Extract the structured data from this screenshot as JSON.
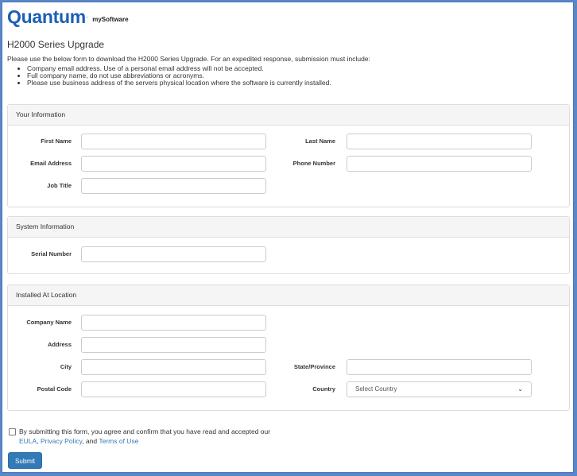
{
  "brand": {
    "logo_text": "Quantum",
    "tm": ".",
    "product": "mySoftware"
  },
  "page": {
    "title": "H2000 Series Upgrade",
    "intro": "Please use the below form to download the H2000 Series Upgrade. For an expedited response, submission must include:",
    "requirements": [
      "Company email address. Use of a personal email address will not be accepted.",
      "Full company name, do not use abbreviations or acronyms.",
      "Please use business address of the servers physical location where the software is currently installed."
    ]
  },
  "your_info": {
    "heading": "Your Information",
    "first_name_label": "First Name",
    "last_name_label": "Last Name",
    "email_label": "Email Address",
    "phone_label": "Phone Number",
    "job_title_label": "Job Title"
  },
  "system_info": {
    "heading": "System Information",
    "serial_label": "Serial Number"
  },
  "location": {
    "heading": "Installed At Location",
    "company_label": "Company Name",
    "address_label": "Address",
    "city_label": "City",
    "state_label": "State/Province",
    "postal_label": "Postal Code",
    "country_label": "Country",
    "country_value": "Select Country"
  },
  "agreement": {
    "text_before": "By submitting this form, you agree and confirm that you have read and accepted our",
    "eula": "EULA",
    "sep1": ", ",
    "privacy": "Privacy Policy",
    "sep2": ", and ",
    "terms": "Terms of Use"
  },
  "submit_label": "Submit",
  "colors": {
    "brand_blue": "#1a5fb4",
    "button_blue": "#337ab7",
    "frame_border": "#4a78bd"
  }
}
